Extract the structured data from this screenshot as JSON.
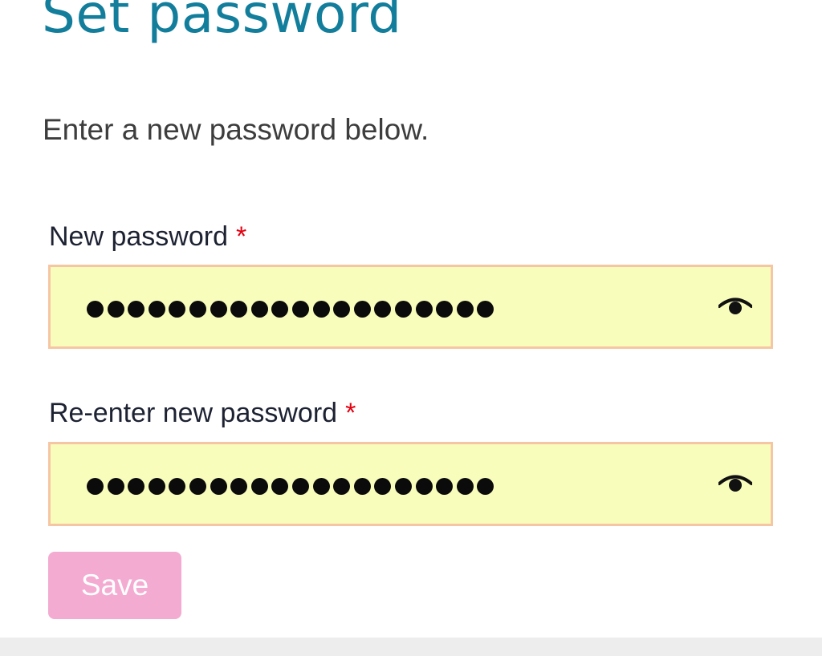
{
  "page": {
    "title": "Set password",
    "instructions": "Enter a new password below."
  },
  "form": {
    "new_password": {
      "label": "New password",
      "required_marker": "*",
      "masked_length": 20,
      "visibility_icon": "eye-icon"
    },
    "confirm_password": {
      "label": "Re-enter new password",
      "required_marker": "*",
      "masked_length": 20,
      "visibility_icon": "eye-icon"
    },
    "save_label": "Save"
  },
  "colors": {
    "title": "#137e9c",
    "field_background": "#f9fdbc",
    "field_border": "#f6c6a4",
    "required_marker": "#e3000f",
    "save_button": "#f3abd1",
    "footer": "#ededed"
  }
}
